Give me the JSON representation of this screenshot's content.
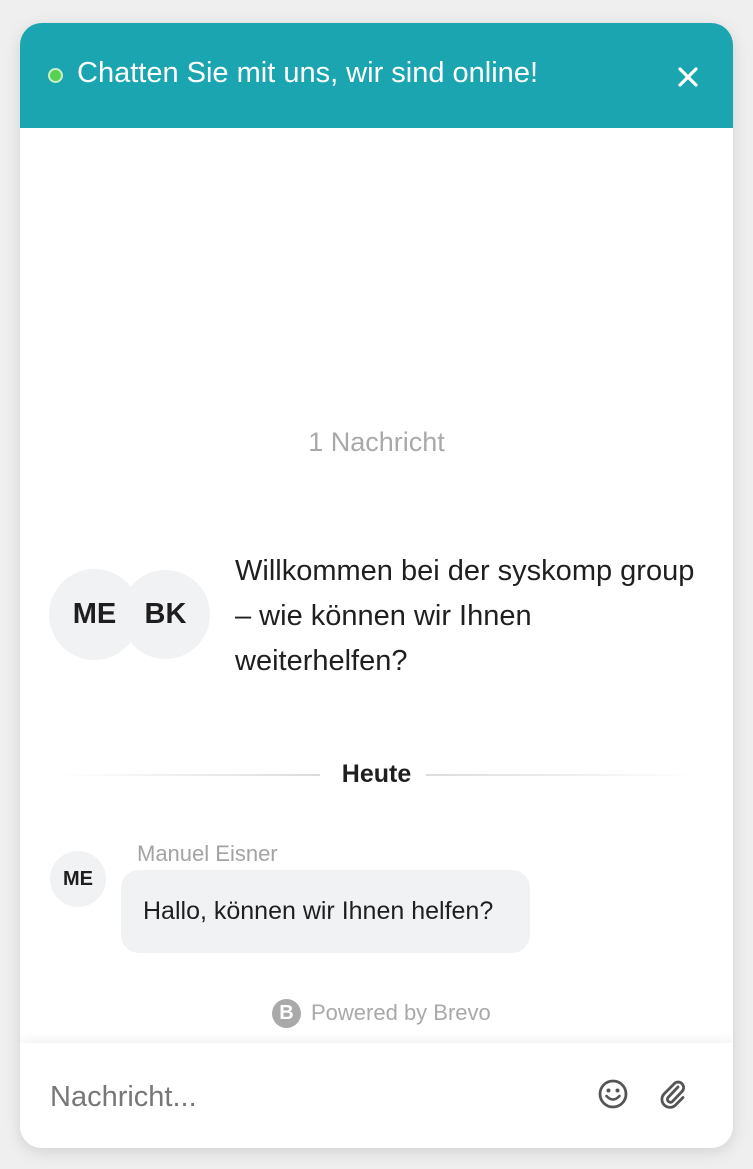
{
  "header": {
    "title": "Chatten Sie mit uns, wir sind online!",
    "status_color": "#58d152",
    "background_color": "#1aa5b0",
    "close_icon": "close-icon"
  },
  "conversation": {
    "message_count_label": "1 Nachricht",
    "welcome": {
      "avatars": [
        "ME",
        "BK"
      ],
      "text": "Willkommen bei der syskomp group – wie können wir Ihnen weiterhelfen?"
    },
    "date_divider": "Heute",
    "messages": [
      {
        "avatar": "ME",
        "sender": "Manuel Eisner",
        "text": "Hallo, können wir Ihnen helfen?"
      }
    ]
  },
  "footer": {
    "powered_by": "Powered by Brevo",
    "logo_letter": "B"
  },
  "composer": {
    "placeholder": "Nachricht...",
    "emoji_icon": "emoji-icon",
    "attach_icon": "paperclip-icon"
  }
}
